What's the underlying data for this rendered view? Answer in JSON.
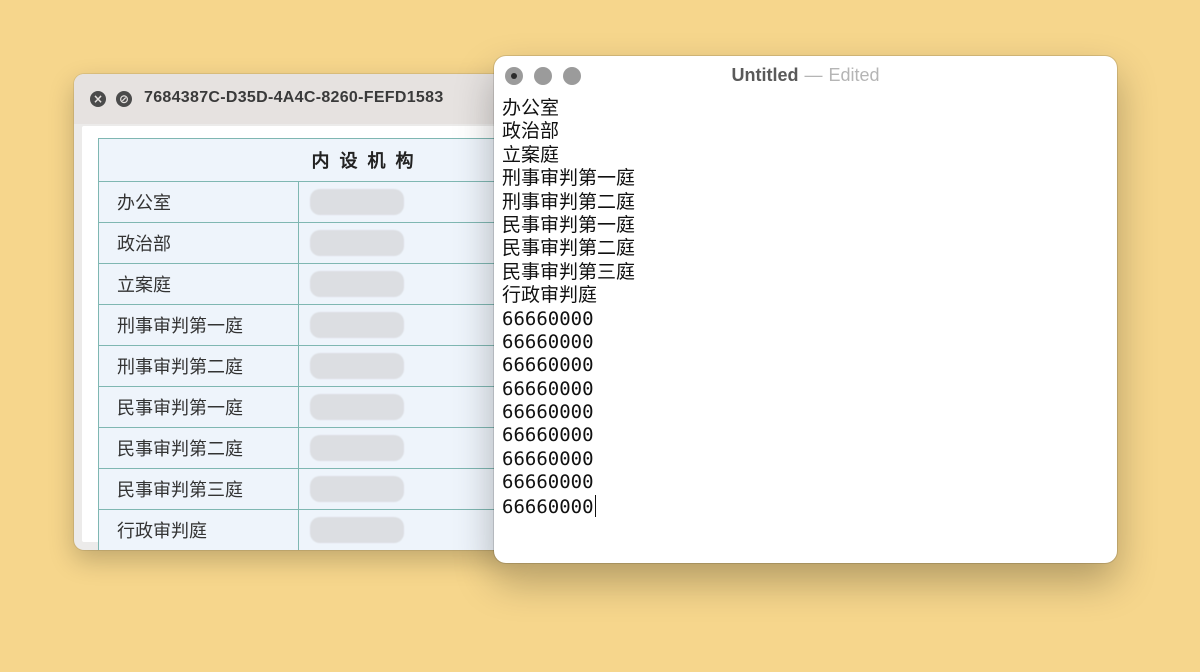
{
  "back_window": {
    "title": "7684387C-D35D-4A4C-8260-FEFD1583",
    "table": {
      "header": "内设机构",
      "rows": [
        {
          "name": "办公室"
        },
        {
          "name": "政治部"
        },
        {
          "name": "立案庭"
        },
        {
          "name": "刑事审判第一庭"
        },
        {
          "name": "刑事审判第二庭"
        },
        {
          "name": "民事审判第一庭"
        },
        {
          "name": "民事审判第二庭"
        },
        {
          "name": "民事审判第三庭"
        },
        {
          "name": "行政审判庭"
        }
      ]
    }
  },
  "front_window": {
    "title": "Untitled",
    "dash": "—",
    "status": "Edited",
    "lines": [
      "办公室",
      "政治部",
      "立案庭",
      "刑事审判第一庭",
      "刑事审判第二庭",
      "民事审判第一庭",
      "民事审判第二庭",
      "民事审判第三庭",
      "行政审判庭",
      "66660000",
      "66660000",
      "66660000",
      "66660000",
      "66660000",
      "66660000",
      "66660000",
      "66660000",
      "66660000"
    ]
  },
  "icons": {
    "back_close": "close-icon",
    "back_block": "block-icon"
  },
  "colors": {
    "desktop_background": "#f6d68c",
    "table_border": "#7fb7b2",
    "table_fill": "#eef4fb"
  }
}
